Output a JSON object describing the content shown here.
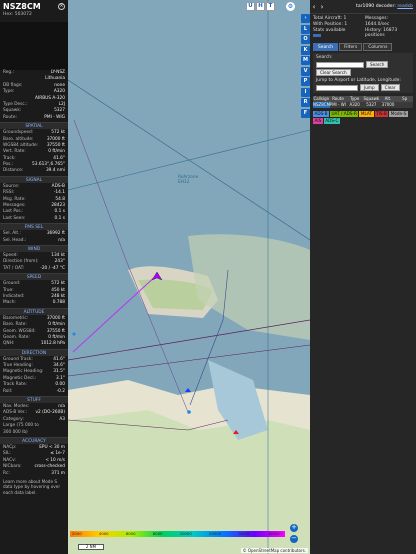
{
  "aircraft": {
    "callsign": "NSZ8CM",
    "hex_label": "Hex:",
    "hex": "503072",
    "close": "×"
  },
  "details": [
    {
      "l": "Reg.:",
      "v": "LY-NSZ"
    },
    {
      "l": "",
      "v": "Lithuania"
    },
    {
      "l": "DB flags:",
      "v": "none"
    },
    {
      "l": "Type:",
      "v": "A320"
    },
    {
      "l": "",
      "v": "AIRBUS A-320"
    },
    {
      "l": "Type Desc.:",
      "v": "L2J"
    },
    {
      "l": "Squawk:",
      "v": "5327"
    },
    {
      "l": "Route:",
      "v": "PMI - WIG"
    }
  ],
  "sections": [
    {
      "title": "SPATIAL",
      "rows": [
        {
          "l": "Groundspeed:",
          "v": "572 kt"
        },
        {
          "l": "Baro. altitude:",
          "v": "37000 ft"
        },
        {
          "l": "WGS84 altitude:",
          "v": "37550 ft"
        },
        {
          "l": "Vert. Rate:",
          "v": "0 ft/min"
        },
        {
          "l": "Track:",
          "v": "41.6°"
        },
        {
          "l": "Pos.:",
          "v": "53.613°,6.765°"
        },
        {
          "l": "Distance:",
          "v": "39.4 nmi"
        }
      ]
    },
    {
      "title": "SIGNAL",
      "rows": [
        {
          "l": "Source:",
          "v": "ADS-B"
        },
        {
          "l": "RSSI:",
          "v": "-14.1"
        },
        {
          "l": "Msg. Rate:",
          "v": "54.8"
        },
        {
          "l": "Messages:",
          "v": "28423"
        },
        {
          "l": "Last Pos.:",
          "v": "0.1 s"
        },
        {
          "l": "Last Seen:",
          "v": "0.1 s"
        }
      ]
    },
    {
      "title": "FMS SEL",
      "rows": [
        {
          "l": "Sel. Alt.:",
          "v": "36992 ft"
        },
        {
          "l": "Sel. Head.:",
          "v": "n/a"
        }
      ]
    },
    {
      "title": "WIND",
      "rows": [
        {
          "l": "Speed:",
          "v": "134 kt"
        },
        {
          "l": "Direction (from):",
          "v": "243°"
        },
        {
          "l": "TAT / OAT:",
          "v": "-20 / -47 °C"
        }
      ]
    },
    {
      "title": "SPEED",
      "rows": [
        {
          "l": "Ground:",
          "v": "572 kt"
        },
        {
          "l": "True:",
          "v": "450 kt"
        },
        {
          "l": "Indicated:",
          "v": "248 kt"
        },
        {
          "l": "Mach:",
          "v": "0.788"
        }
      ]
    },
    {
      "title": "ALTITUDE",
      "rows": [
        {
          "l": "Barometric:",
          "v": "37000 ft"
        },
        {
          "l": "Baro. Rate:",
          "v": "0 ft/min"
        },
        {
          "l": "Geom. WGS84:",
          "v": "37550 ft"
        },
        {
          "l": "Geom. Rate:",
          "v": "0 ft/min"
        },
        {
          "l": "QNH:",
          "v": "1012.8 hPa"
        }
      ]
    },
    {
      "title": "DIRECTION",
      "rows": [
        {
          "l": "Ground Track:",
          "v": "41.6°"
        },
        {
          "l": "True Heading:",
          "v": "34.6°"
        },
        {
          "l": "Magnetic Heading:",
          "v": "31.5°"
        },
        {
          "l": "Magnetic Decl.:",
          "v": "3.1°"
        },
        {
          "l": "Track Rate:",
          "v": "0.00"
        },
        {
          "l": "Roll:",
          "v": "-0.2"
        }
      ]
    },
    {
      "title": "STUFF",
      "rows": [
        {
          "l": "Nav. Modes:",
          "v": "n/a"
        },
        {
          "l": "ADS-B Ver.:",
          "v": "v2 (DO-260B)"
        },
        {
          "l": "Category:",
          "v": "A3"
        },
        {
          "l": "Large (75 000 to",
          "v": ""
        },
        {
          "l": "300 000 lb)",
          "v": ""
        }
      ]
    },
    {
      "title": "ACCURACY",
      "rows": [
        {
          "l": "NACp:",
          "v": "EPU < 30 m"
        },
        {
          "l": "SIL:",
          "v": "≤ 1e-7"
        },
        {
          "l": "NACv:",
          "v": "< 10 m/s"
        },
        {
          "l": "NICbaro:",
          "v": "cross-checked"
        },
        {
          "l": "Rc:",
          "v": "371 m"
        }
      ]
    }
  ],
  "footer_note": "Learn more about Mode S data type by hovering over each data label.",
  "right": {
    "logo": "tar1090",
    "decoder_label": "decoder:",
    "decoder": "readsb",
    "total_aircraft": "Total Aircraft: 1",
    "with_position": "With Position: 1",
    "stats_available": "Stats available",
    "messages": "Messages: 1644.0/sec",
    "history": "History: 16873 positions",
    "tabs": [
      "Search",
      "Filters",
      "Columns"
    ],
    "search_label": "Search:",
    "search_btn": "Search",
    "clear_search": "Clear Search",
    "jump_label": "Jump to Airport or Latitude, Longitude:",
    "jump_btn": "Jump",
    "clear_btn": "Clear",
    "columns": [
      "Callsign",
      "Route",
      "Type",
      "Squawk",
      "Alt.",
      "Sp"
    ],
    "row": [
      "NSZ8CM",
      "PMI - WIG",
      "A320",
      "5327",
      "37000",
      ""
    ],
    "tags": [
      {
        "t": "ADS-B",
        "c": "#4a90e2"
      },
      {
        "t": "UAT / ADS-R",
        "c": "#7fb800"
      },
      {
        "t": "MLAT",
        "c": "#ffb000"
      },
      {
        "t": "TIS-B",
        "c": "#c83232"
      },
      {
        "t": "Mode-S",
        "c": "#9e9e9e"
      },
      {
        "t": "AIS",
        "c": "#e040a0"
      },
      {
        "t": "ADS-C",
        "c": "#30c0b0"
      }
    ]
  },
  "map": {
    "toolbar": [
      "U",
      "H",
      "T"
    ],
    "side_buttons": [
      "L",
      "O",
      "K",
      "M",
      "V",
      "P",
      "I",
      "R",
      "F"
    ],
    "area_label": "Ruhrzone",
    "area_label2": "EH12",
    "scale": "2 NM",
    "attribution": "© OpenStreetMap contributors.",
    "legend": [
      "2000",
      "4000",
      "6000",
      "8000",
      "10000",
      "20000",
      "30000",
      "40000+"
    ]
  }
}
